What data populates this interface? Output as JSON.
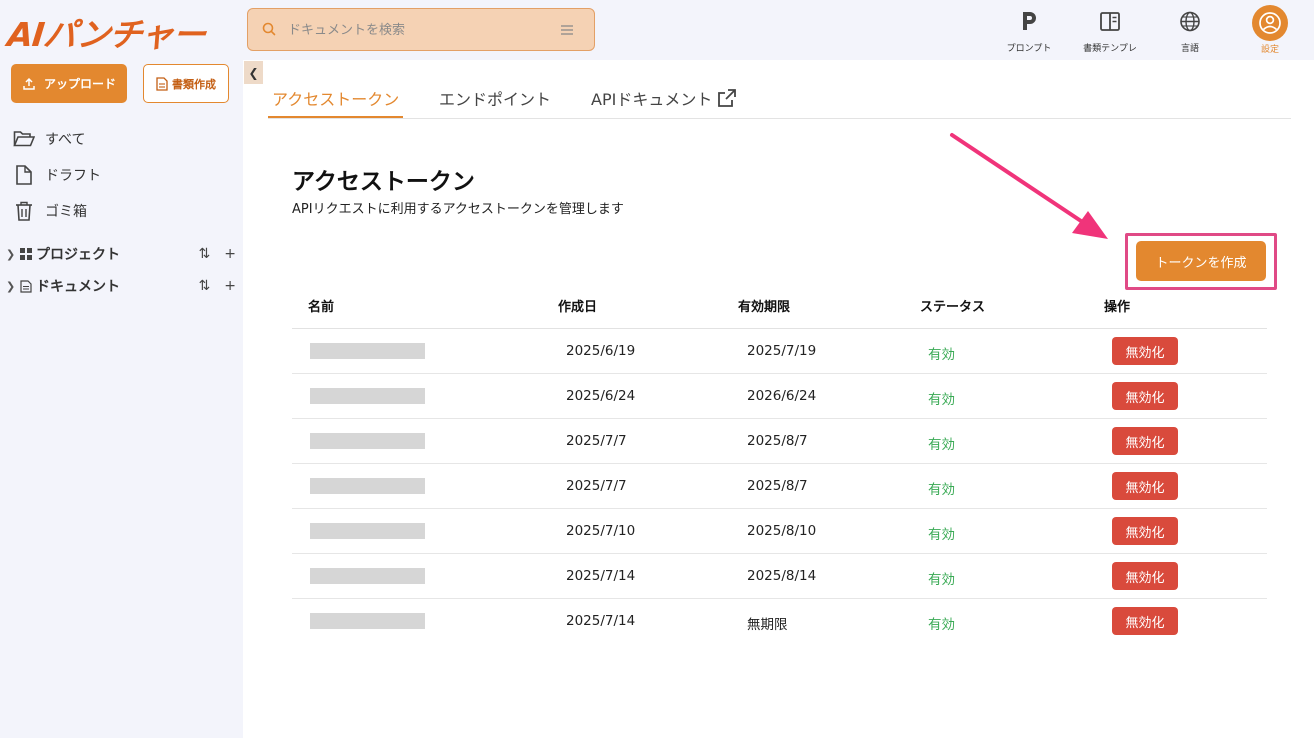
{
  "app": {
    "logo_text": "AIパンチャー"
  },
  "search": {
    "placeholder": "ドキュメントを検索",
    "icon": "search-icon"
  },
  "topnav": [
    {
      "label": "プロンプト",
      "icon": "p-icon"
    },
    {
      "label": "書類テンプレ",
      "icon": "template-icon"
    },
    {
      "label": "言語",
      "icon": "globe-icon"
    },
    {
      "label": "設定",
      "icon": "user-settings-icon"
    }
  ],
  "sidebar": {
    "upload_label": "アップロード",
    "create_doc_label": "書類作成",
    "items": [
      {
        "label": "すべて",
        "icon": "folder-open-icon"
      },
      {
        "label": "ドラフト",
        "icon": "file-icon"
      },
      {
        "label": "ゴミ箱",
        "icon": "trash-icon"
      }
    ],
    "sections": [
      {
        "label": "プロジェクト",
        "icon": "grid-icon"
      },
      {
        "label": "ドキュメント",
        "icon": "document-icon"
      }
    ]
  },
  "tabs": [
    {
      "label": "アクセストークン",
      "active": true
    },
    {
      "label": "エンドポイント",
      "active": false
    },
    {
      "label": "APIドキュメント",
      "active": false,
      "icon": "external-link-icon"
    }
  ],
  "page": {
    "title": "アクセストークン",
    "subtitle": "APIリクエストに利用するアクセストークンを管理します",
    "create_button": "トークンを作成"
  },
  "table": {
    "headers": [
      "名前",
      "作成日",
      "有効期限",
      "ステータス",
      "操作"
    ],
    "rows": [
      {
        "created": "2025/6/19",
        "expires": "2025/7/19",
        "status": "有効",
        "action": "無効化"
      },
      {
        "created": "2025/6/24",
        "expires": "2026/6/24",
        "status": "有効",
        "action": "無効化"
      },
      {
        "created": "2025/7/7",
        "expires": "2025/8/7",
        "status": "有効",
        "action": "無効化"
      },
      {
        "created": "2025/7/7",
        "expires": "2025/8/7",
        "status": "有効",
        "action": "無効化"
      },
      {
        "created": "2025/7/10",
        "expires": "2025/8/10",
        "status": "有効",
        "action": "無効化"
      },
      {
        "created": "2025/7/14",
        "expires": "2025/8/14",
        "status": "有効",
        "action": "無効化"
      },
      {
        "created": "2025/7/14",
        "expires": "無期限",
        "status": "有効",
        "action": "無効化"
      }
    ]
  },
  "colors": {
    "accent": "#e3882f",
    "logo": "#e0621f",
    "status_active": "#3aaa55",
    "danger": "#d94a3c",
    "highlight": "#e04a86"
  }
}
